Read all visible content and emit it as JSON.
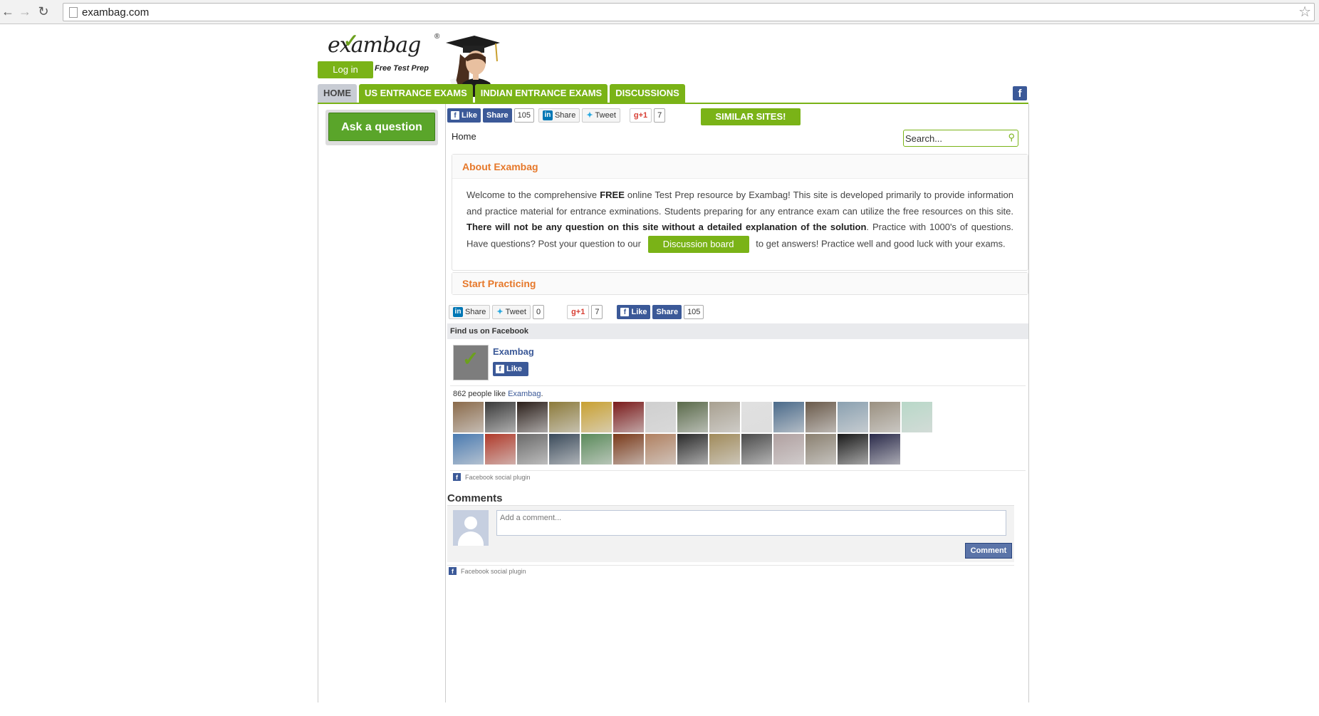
{
  "browser": {
    "url": "exambag.com"
  },
  "header": {
    "logo_text": "exambag",
    "logo_tagline": "Free Test Prep",
    "login_label": "Log in"
  },
  "nav": {
    "tabs": [
      {
        "label": "HOME",
        "active": true
      },
      {
        "label": "US ENTRANCE EXAMS",
        "active": false
      },
      {
        "label": "INDIAN ENTRANCE EXAMS",
        "active": false
      },
      {
        "label": "DISCUSSIONS",
        "active": false
      }
    ]
  },
  "sidebar": {
    "ask_label": "Ask a question"
  },
  "share_top": {
    "like": "Like",
    "share": "Share",
    "fb_count": "105",
    "li_share": "Share",
    "tweet": "Tweet",
    "gplus": "+1",
    "gplus_count": "7"
  },
  "similar_label": "SIMILAR SITES!",
  "breadcrumb": "Home",
  "search": {
    "placeholder": "Search..."
  },
  "about": {
    "title": "About Exambag",
    "p1": "Welcome to the comprehensive ",
    "free": "FREE",
    "p2": " online Test Prep resource by Exambag! This site is developed primarily to provide information and practice material for entrance exminations. Students preparing for any entrance exam can utilize the free resources on this site. ",
    "bold": "There will not be any question on this site without a detailed explanation of the solution",
    "p3": ". Practice with 1000's of questions. Have questions? Post your question to our ",
    "discussion_label": "Discussion board",
    "p4": " to get answers! Practice well and good luck with your exams."
  },
  "start_practicing": "Start Practicing",
  "share_bottom": {
    "li_share": "Share",
    "tweet": "Tweet",
    "tweet_count": "0",
    "gplus": "+1",
    "gplus_count": "7",
    "like": "Like",
    "share": "Share",
    "fb_count": "105"
  },
  "facebook": {
    "heading": "Find us on Facebook",
    "page_name": "Exambag",
    "like": "Like",
    "count_text": "862 people like ",
    "count_link": "Exambag",
    "count_end": ".",
    "plugin_label": "Facebook social plugin",
    "face_colors": [
      "#8a6a4a",
      "#3a3a3a",
      "#2b1f1a",
      "#8c7a3a",
      "#c9a030",
      "#7a1a1a",
      "#cfcfcf",
      "#5a6a4a",
      "#a8a090",
      "#e0e0e0",
      "#4a6a8a",
      "#6a5a4a",
      "#8aa0b0",
      "#9a9080",
      "#b8d8c8",
      "#4a7ab0",
      "#b03a2a",
      "#6a6a6a",
      "#3a4a5a",
      "#5a8a5a",
      "#7a3a1a",
      "#b08060",
      "#2a2a2a",
      "#a08a5a",
      "#4a4a4a",
      "#b0a0a0",
      "#8a8070",
      "#1a1a1a",
      "#2a2a4a"
    ]
  },
  "comments": {
    "heading": "Comments",
    "placeholder": "Add a comment...",
    "button": "Comment",
    "plugin_label": "Facebook social plugin"
  }
}
